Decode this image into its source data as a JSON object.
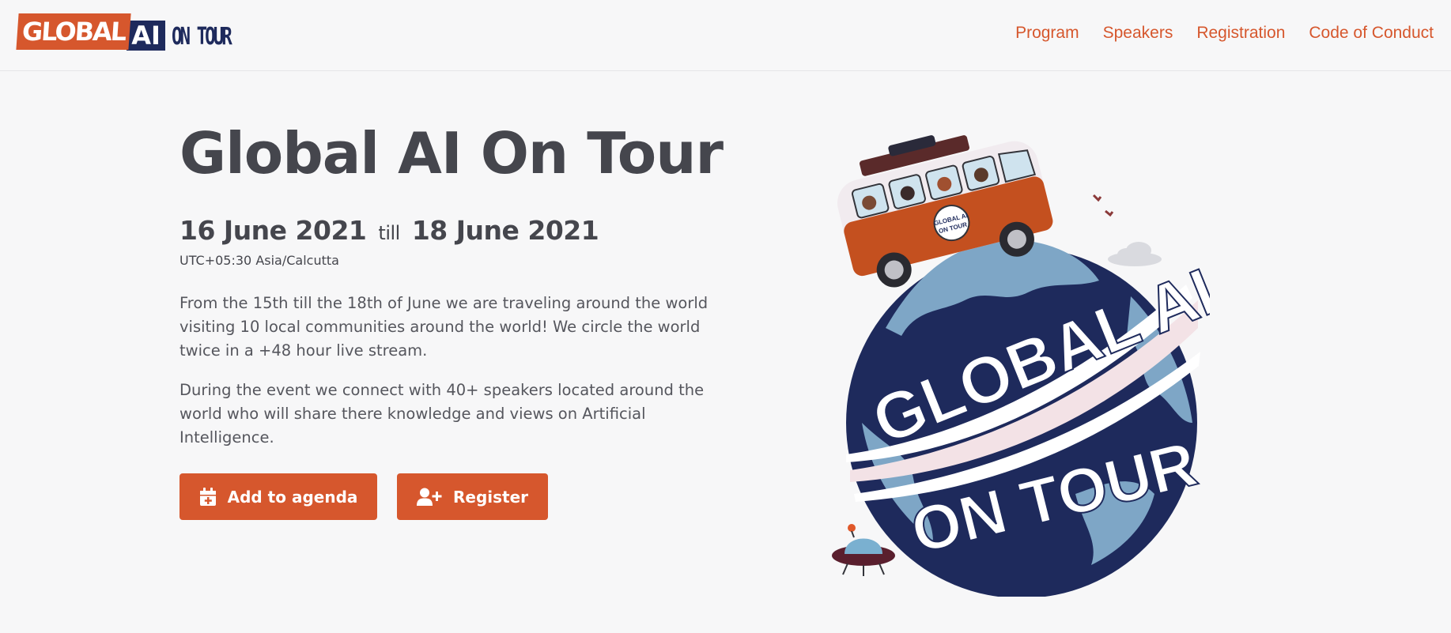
{
  "logo": {
    "part1": "GLOBAL",
    "part2": "AI",
    "part3": "ON TOUR"
  },
  "nav": [
    {
      "label": "Program"
    },
    {
      "label": "Speakers"
    },
    {
      "label": "Registration"
    },
    {
      "label": "Code of Conduct"
    }
  ],
  "hero": {
    "title": "Global AI On Tour",
    "start_date": "16 June 2021",
    "till": "till",
    "end_date": "18 June 2021",
    "timezone": "UTC+05:30 Asia/Calcutta",
    "paragraph1": "From the 15th till the 18th of June we are traveling around the world visiting 10 local communities around the world! We circle the world twice in a +48 hour live stream.",
    "paragraph2": "During the event we connect with 40+ speakers located around the world who will share there knowledge and views on Artificial Intelligence."
  },
  "buttons": {
    "agenda": {
      "label": "Add to agenda",
      "icon": "calendar-plus-icon"
    },
    "register": {
      "label": "Register",
      "icon": "user-plus-icon"
    }
  },
  "illustration": {
    "globe_text_1": "GLOBAL AI",
    "globe_text_2": "ON TOUR",
    "van_text_1": "GLOBAL AI",
    "van_text_2": "ON TOUR"
  },
  "colors": {
    "accent": "#d6572d",
    "navy": "#1e2a5c",
    "text": "#45464d",
    "background": "#f7f7f8"
  }
}
